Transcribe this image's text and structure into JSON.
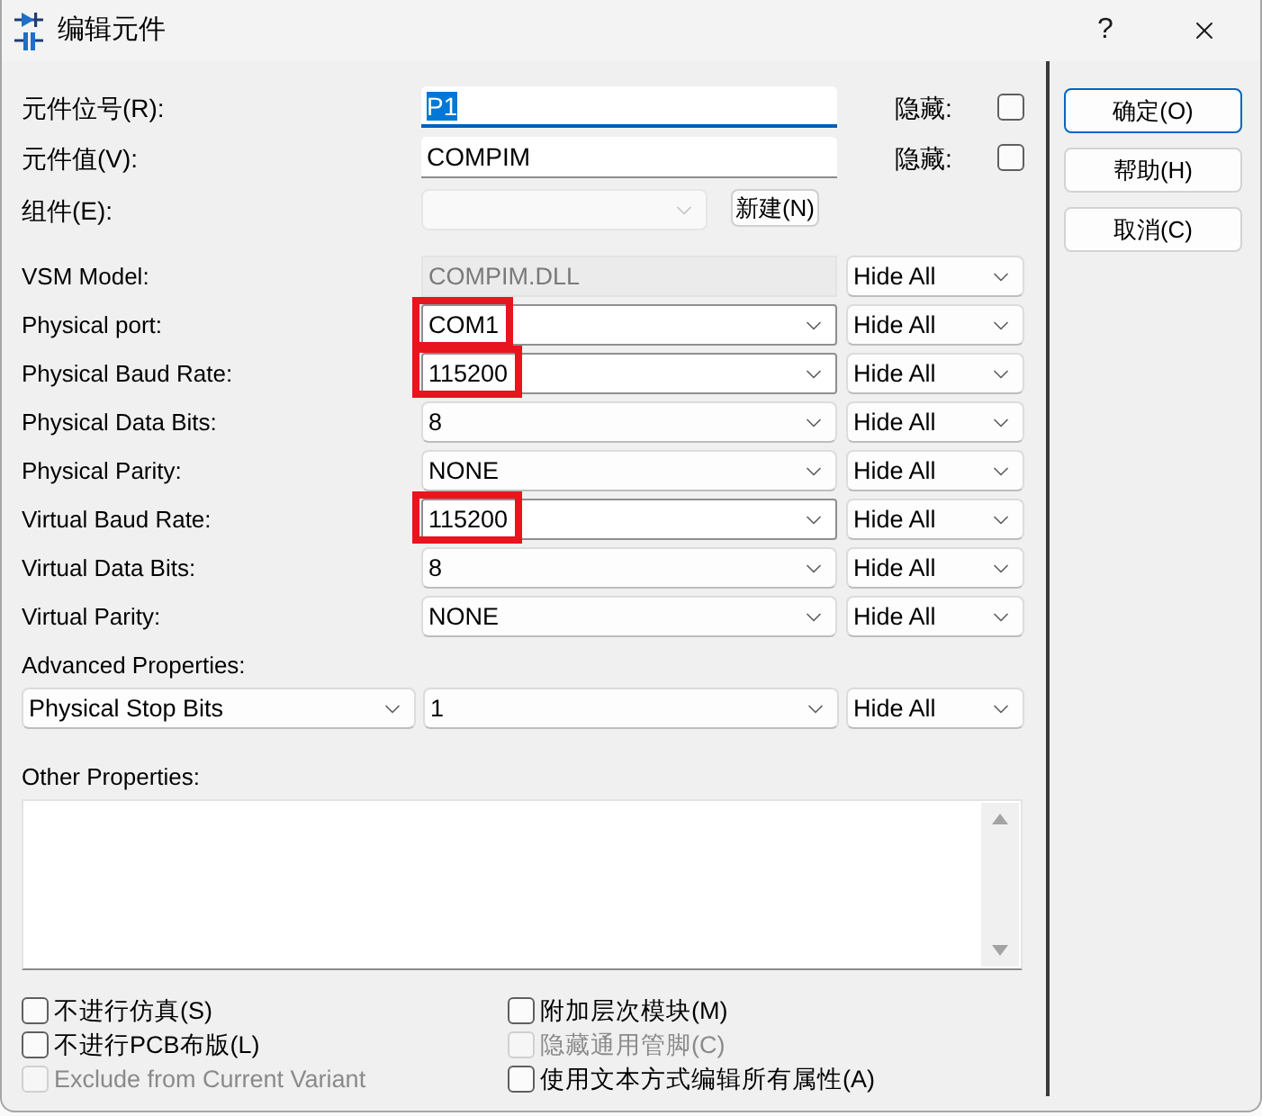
{
  "window": {
    "title": "编辑元件",
    "help_button": "?"
  },
  "fields": [
    {
      "label": "元件位号(R):",
      "value": "P1",
      "focused": true,
      "hide_label": "隐藏:",
      "hidden": false
    },
    {
      "label": "元件值(V):",
      "value": "COMPIM",
      "focused": false,
      "hide_label": "隐藏:",
      "hidden": false
    }
  ],
  "group": {
    "label": "组件(E):",
    "disabled": true,
    "new_button": "新建(N)"
  },
  "properties": [
    {
      "label": "VSM Model:",
      "kind": "readonly",
      "value": "COMPIM.DLL",
      "highlighted": false,
      "visibility": "Hide All"
    },
    {
      "label": "Physical port:",
      "kind": "editable",
      "value": "COM1",
      "highlighted": true,
      "visibility": "Hide All"
    },
    {
      "label": "Physical Baud Rate:",
      "kind": "editable",
      "value": "115200",
      "highlighted": true,
      "visibility": "Hide All"
    },
    {
      "label": "Physical Data Bits:",
      "kind": "list",
      "value": "8",
      "highlighted": false,
      "visibility": "Hide All"
    },
    {
      "label": "Physical Parity:",
      "kind": "list",
      "value": "NONE",
      "highlighted": false,
      "visibility": "Hide All"
    },
    {
      "label": "Virtual Baud Rate:",
      "kind": "editable",
      "value": "115200",
      "highlighted": true,
      "visibility": "Hide All"
    },
    {
      "label": "Virtual Data Bits:",
      "kind": "list",
      "value": "8",
      "highlighted": false,
      "visibility": "Hide All"
    },
    {
      "label": "Virtual Parity:",
      "kind": "list",
      "value": "NONE",
      "highlighted": false,
      "visibility": "Hide All"
    }
  ],
  "advanced": {
    "label": "Advanced Properties:",
    "property": "Physical Stop Bits",
    "value": "1",
    "visibility": "Hide All"
  },
  "other_properties": {
    "label": "Other Properties:"
  },
  "options": {
    "column_1": [
      {
        "label": "不进行仿真(S)",
        "checked": false,
        "disabled": false
      },
      {
        "label": "不进行PCB布版(L)",
        "checked": false,
        "disabled": false
      },
      {
        "label": "Exclude from Current Variant",
        "checked": false,
        "disabled": true
      }
    ],
    "column_2": [
      {
        "label": "附加层次模块(M)",
        "checked": false,
        "disabled": false
      },
      {
        "label": "隐藏通用管脚(C)",
        "checked": false,
        "disabled": true
      },
      {
        "label": "使用文本方式编辑所有属性(A)",
        "checked": false,
        "disabled": false
      }
    ]
  },
  "buttons": [
    {
      "label": "确定(O)",
      "default": true
    },
    {
      "label": "帮助(H)",
      "default": false
    },
    {
      "label": "取消(C)",
      "default": false
    }
  ]
}
